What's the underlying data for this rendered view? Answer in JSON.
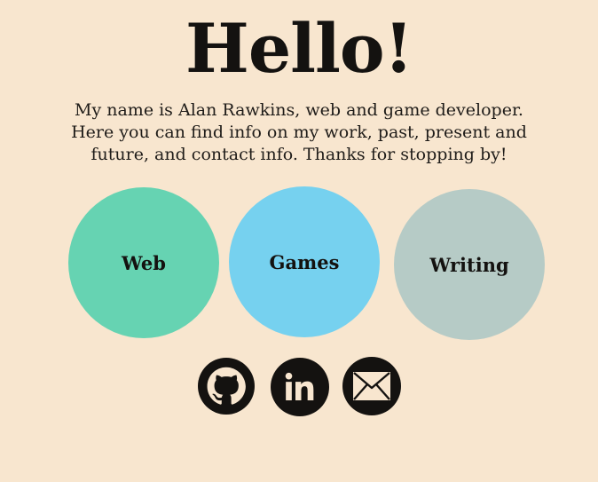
{
  "heading": "Hello!",
  "intro": "My name is Alan Rawkins, web and game developer. Here you can find info on my work, past, present and future, and contact info. Thanks for stopping by!",
  "categories": [
    {
      "label": "Web",
      "color": "#66d3b2"
    },
    {
      "label": "Games",
      "color": "#76d1ef"
    },
    {
      "label": "Writing",
      "color": "#b6cbc6"
    }
  ],
  "social": [
    {
      "icon": "github-icon"
    },
    {
      "icon": "linkedin-icon"
    },
    {
      "icon": "email-icon"
    }
  ],
  "colors": {
    "background": "#f8e6cf",
    "text": "#141210"
  }
}
